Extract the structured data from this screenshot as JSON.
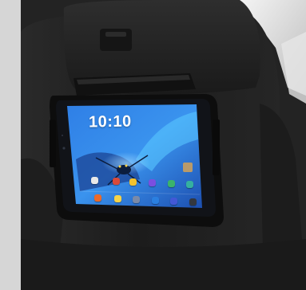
{
  "tablet": {
    "clock_text": "10:10",
    "date_text": "",
    "weather_text": "",
    "home_icons_row1": [
      {
        "icon": "google-app-icon",
        "color": "#e8e8e8"
      },
      {
        "icon": "gallery-app-icon",
        "color": "#d94a3a"
      },
      {
        "icon": "chrome-app-icon",
        "color": "#f2c230"
      },
      {
        "icon": "play-store-app-icon",
        "color": "#7b4fe0"
      },
      {
        "icon": "contacts-app-icon",
        "color": "#3bb36b"
      },
      {
        "icon": "photos-app-icon",
        "color": "#35b0a0"
      }
    ],
    "home_icons_row2": [
      {
        "icon": "email-app-icon",
        "color": "#ec6a2a"
      },
      {
        "icon": "calendar-app-icon",
        "color": "#f5d34a"
      },
      {
        "icon": "messages-app-icon",
        "color": "#7a8aa8"
      },
      {
        "icon": "camera-app-icon",
        "color": "#2a7fe0"
      },
      {
        "icon": "internet-app-icon",
        "color": "#4258d6"
      },
      {
        "icon": "apps-grid-icon",
        "color": "#33373f"
      }
    ]
  },
  "colors": {
    "seat_dark": "#1f1f1f",
    "seat_mid": "#2c2c2c",
    "background_light": "#d9d9d9",
    "screen_sky": "#3a8fe8"
  }
}
